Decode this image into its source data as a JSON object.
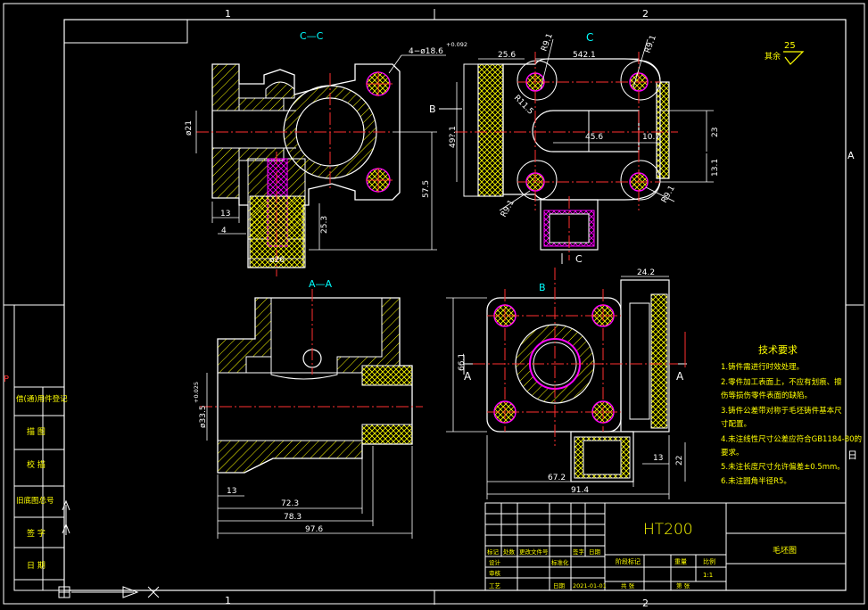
{
  "zone_labels": {
    "top_1": "1",
    "top_2": "2",
    "bottom_1": "1",
    "bottom_2": "2",
    "right_a": "A",
    "right_b": "日",
    "left_p": "P"
  },
  "views": {
    "cc_title": "C—C",
    "c_title": "C",
    "aa_title": "A—A",
    "b_title": "B",
    "b_marker": "B",
    "c_marker_bottom": "C",
    "a_marker_left": "A",
    "a_marker_right": "A"
  },
  "roughness": {
    "label": "其余",
    "value": "25"
  },
  "dimensions": {
    "cc": {
      "holes": "4−ø18.6",
      "holes_tol": "+0.092",
      "d21": "ø21",
      "d13": "13",
      "d4": "4",
      "d26": "ø26",
      "d25_3": "25.3",
      "d57_5": "57.5"
    },
    "c": {
      "d25_6": "25.6",
      "d54_1": "542.1",
      "r9_1a": "R9.1",
      "r9_1b": "R9.1",
      "r9_1c": "R9.1",
      "r9_1d": "R9.1",
      "r11_5": "R11.5",
      "d45_6": "45.6",
      "d10_7": "10.7",
      "d49_1": "49?.1",
      "d23": "23",
      "d13_1": "13.1"
    },
    "aa": {
      "d33_5": "ø33.5",
      "d33_5_tol": "+0.025",
      "d13": "13",
      "d72_3": "72.3",
      "d78_3": "78.3",
      "d97_6": "97.6"
    },
    "b": {
      "d24_2": "24.2",
      "d66_1": "66.1",
      "d13": "13",
      "d22": "22",
      "d67_2": "67.2",
      "d91_4": "91.4"
    }
  },
  "tech_req": {
    "title": "技术要求",
    "items": [
      "1.铸件需进行时效处理。",
      "2.零件加工表面上，不应有划痕、擦",
      "伤等损伤零件表面的缺陷。",
      "3.铸件公差带对称于毛坯铸件基本尺",
      "寸配置。",
      "4.未注线性尺寸公差应符合GB1184-80的",
      "要求。",
      "5.未注长度尺寸允许偏差±0.5mm。",
      "6.未注圆角半径R5。"
    ]
  },
  "left_strip": [
    "借(通)用件登记",
    "描  图",
    "校  描",
    "旧底图总号",
    "签  字",
    "日  期"
  ],
  "title_block": {
    "material": "HT200",
    "drawing_name": "毛坯图",
    "headers": [
      "标记",
      "处数",
      "更改文件号",
      "签字",
      "日期"
    ],
    "row2": [
      "设计",
      "标准化"
    ],
    "stage_labels": [
      "阶段标记",
      "重量",
      "比例"
    ],
    "scale": "1:1",
    "row3": [
      "审核"
    ],
    "row4": [
      "工艺",
      "日期",
      "2021-01-01",
      "共  张",
      "第  张"
    ]
  }
}
